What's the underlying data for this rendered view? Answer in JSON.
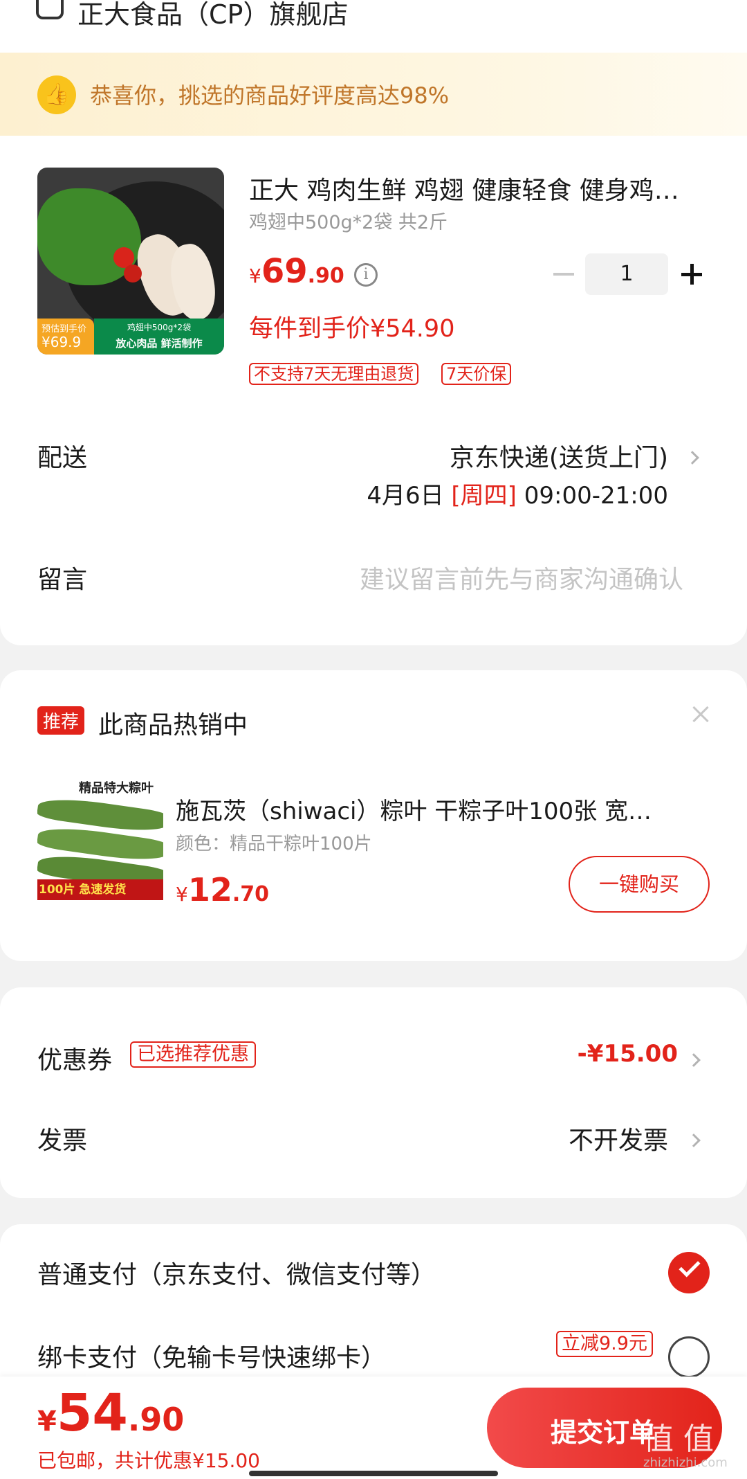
{
  "store": {
    "name": "正大食品（CP）旗舰店"
  },
  "banner": {
    "text": "恭喜你，挑选的商品好评度高达98%"
  },
  "product": {
    "title": "正大 鸡肉生鲜 鸡翅 健康轻食 健身鸡…",
    "spec": "鸡翅中500g*2袋 共2斤",
    "price_symbol": "¥",
    "price_int": "69",
    "price_dec": ".90",
    "quantity": "1",
    "final_price_text": "每件到手价¥54.90",
    "tags": [
      "不支持7天无理由退货",
      "7天价保"
    ],
    "image_texts": {
      "badge_title": "预估到手价",
      "badge_price": "¥69.9",
      "strip_top": "鸡翅中500g*2袋",
      "strip_bottom": "放心肉品 鲜活制作"
    }
  },
  "delivery": {
    "label": "配送",
    "method": "京东快递(送货上门)",
    "date": "4月6日",
    "weekday": "[周四]",
    "time": "09:00-21:00"
  },
  "message": {
    "label": "留言",
    "placeholder": "建议留言前先与商家沟通确认"
  },
  "recommend": {
    "badge": "推荐",
    "title": "此商品热销中",
    "product_title": "施瓦茨（shiwaci）粽叶 干粽子叶100张 宽…",
    "color": "颜色：精品干粽叶100片",
    "price_symbol": "¥",
    "price_int": "12",
    "price_dec": ".70",
    "buy_label": "一键购买",
    "image_texts": {
      "top": "精品特大粽叶",
      "bottom": "100片 急速发货"
    }
  },
  "coupon": {
    "label": "优惠券",
    "tag": "已选推荐优惠",
    "value": "-¥15.00"
  },
  "invoice": {
    "label": "发票",
    "value": "不开发票"
  },
  "payment": {
    "normal": "普通支付（京东支付、微信支付等）",
    "card": "绑卡支付（免输卡号快速绑卡）",
    "card_promo": "立减9.9元"
  },
  "footer": {
    "price_symbol": "¥",
    "price_int": "54",
    "price_dec": ".90",
    "note": "已包邮，共计优惠¥15.00",
    "submit_label": "提交订单",
    "watermark": "值 值 值",
    "watermark_sub": "zhizhizhi.com"
  },
  "colors": {
    "accent": "#e2231a",
    "banner_bg": "#fdf3d6",
    "banner_text": "#c0762a"
  }
}
